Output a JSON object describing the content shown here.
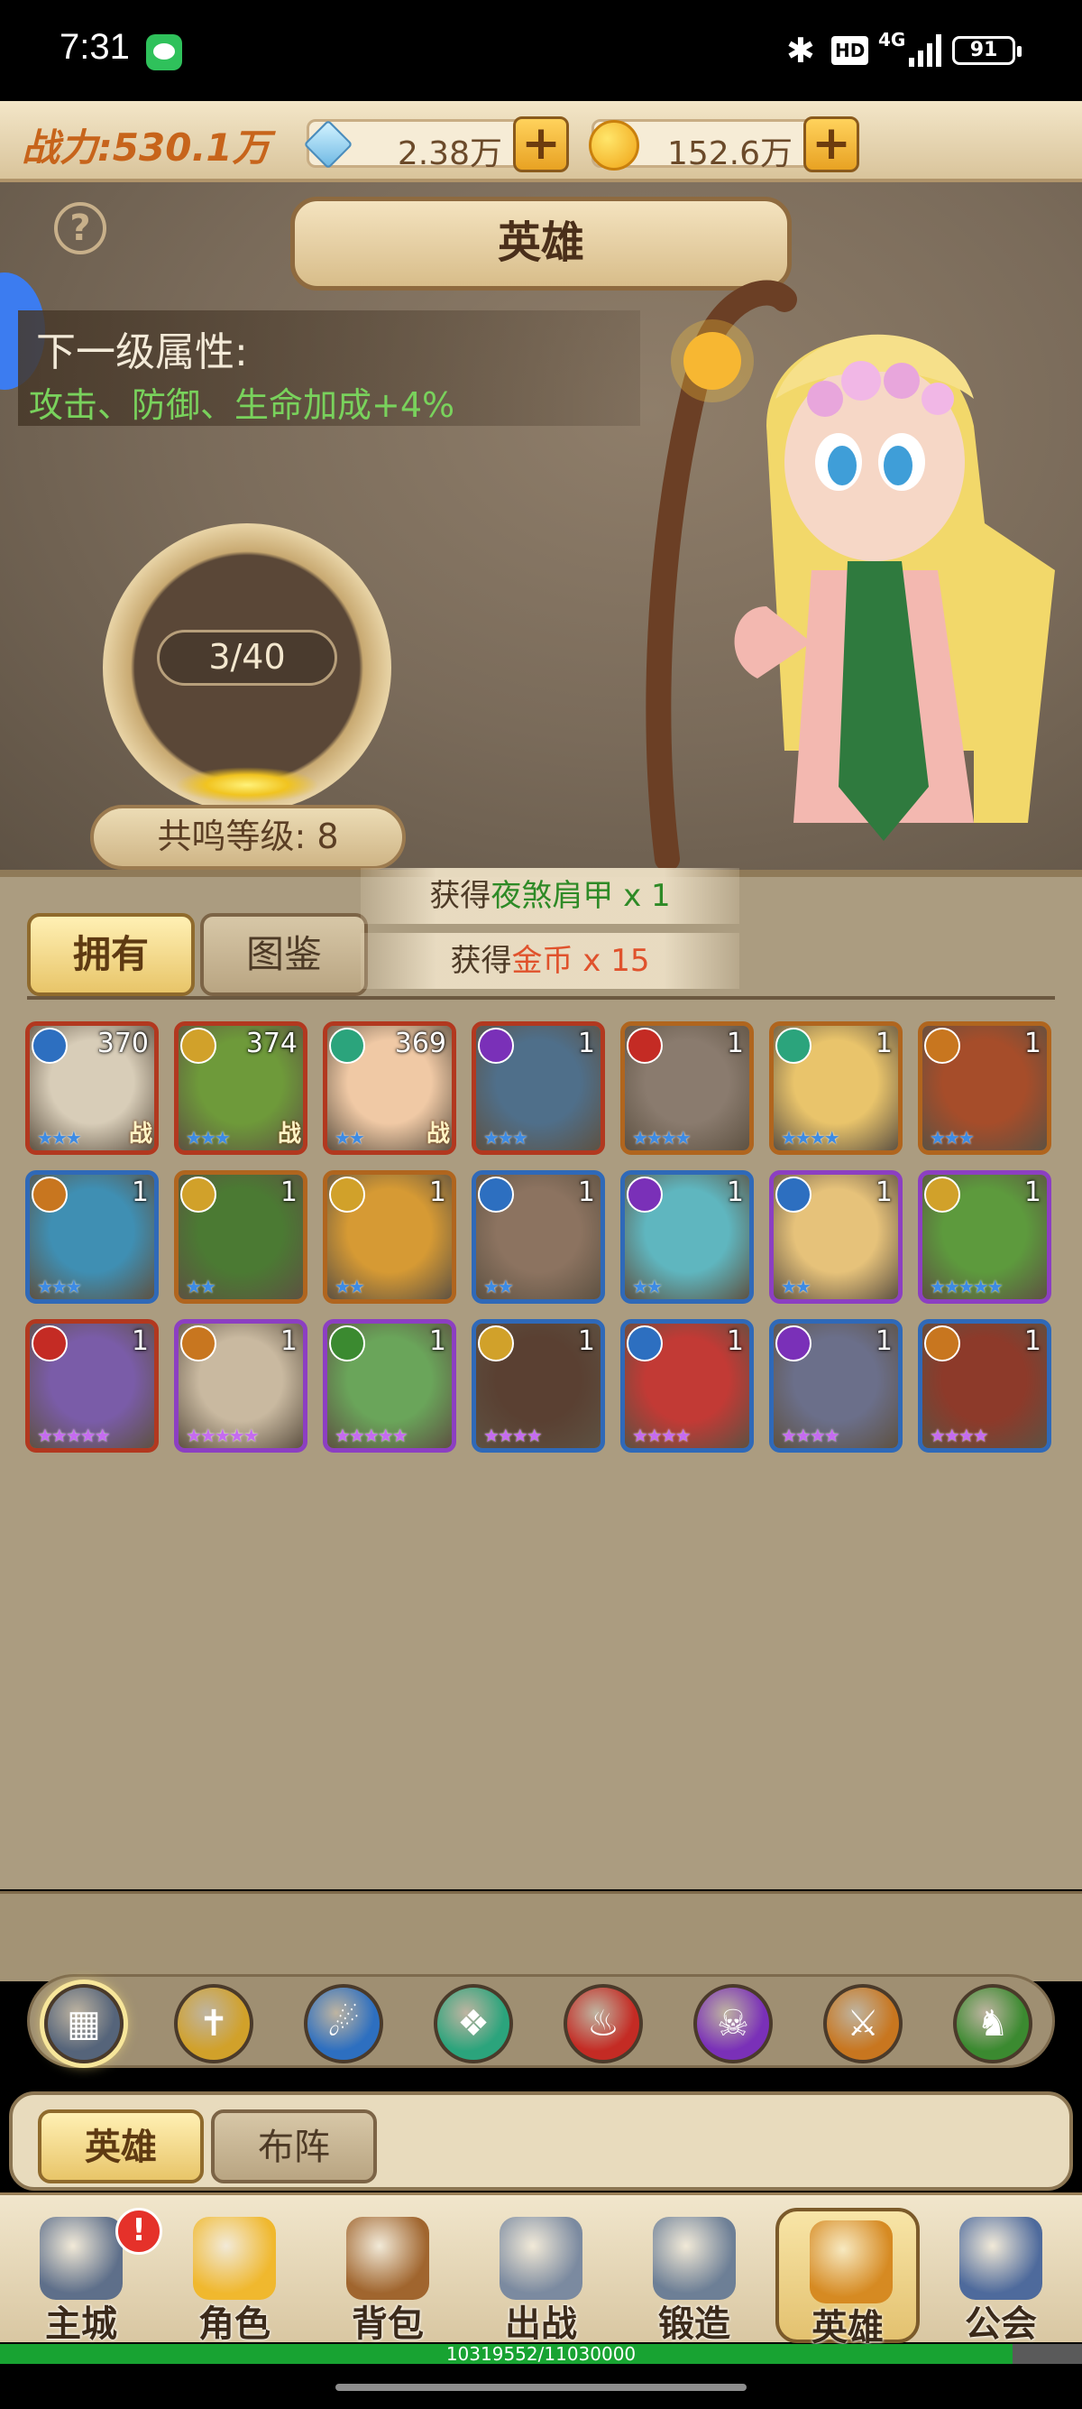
{
  "status_bar": {
    "time": "7:31",
    "hd": "HD",
    "network": "4G",
    "battery": "91",
    "icons": [
      "wechat-icon",
      "bluetooth-icon",
      "signal-icon",
      "battery-icon"
    ]
  },
  "top_bar": {
    "power": "战力:530.1万",
    "diamonds": "2.38万",
    "gold": "152.6万"
  },
  "scene": {
    "title": "英雄",
    "next_level_label": "下一级属性:",
    "next_level_bonus": "攻击、防御、生命加成+4%",
    "progress_text": "3/40",
    "resonance_level": "共鸣等级: 8"
  },
  "tabs": {
    "owned": "拥有",
    "guide": "图鉴"
  },
  "toasts": [
    {
      "prefix": "获得",
      "item": "夜煞肩甲",
      "suffix": " x 1",
      "color": "green"
    },
    {
      "prefix": "获得",
      "item": "金币",
      "suffix": " x 15",
      "color": "red"
    }
  ],
  "heroes": [
    {
      "level": "370",
      "stars": "★★★",
      "battle": "战",
      "border": "red",
      "faction": "water",
      "face": "#d8cdb8"
    },
    {
      "level": "374",
      "stars": "★★★",
      "battle": "战",
      "border": "red",
      "faction": "holy",
      "face": "#6e9a3a"
    },
    {
      "level": "369",
      "stars": "★★",
      "battle": "战",
      "border": "red",
      "faction": "nature",
      "face": "#f0c9a5"
    },
    {
      "level": "1",
      "stars": "★★★",
      "battle": "",
      "border": "red",
      "faction": "shadow",
      "face": "#4f6f8a"
    },
    {
      "level": "1",
      "stars": "★★★★",
      "battle": "",
      "border": "gold",
      "faction": "fire",
      "face": "#8a7b6e"
    },
    {
      "level": "1",
      "stars": "★★★★",
      "battle": "",
      "border": "gold",
      "faction": "nature",
      "face": "#e9c46b"
    },
    {
      "level": "1",
      "stars": "★★★",
      "battle": "",
      "border": "gold",
      "faction": "chaos",
      "face": "#a64d2a"
    },
    {
      "level": "1",
      "stars": "★★★",
      "battle": "",
      "border": "blue",
      "faction": "chaos",
      "face": "#3f8fb3"
    },
    {
      "level": "1",
      "stars": "★★",
      "battle": "",
      "border": "gold",
      "faction": "holy",
      "face": "#4b7a33"
    },
    {
      "level": "1",
      "stars": "★★",
      "battle": "",
      "border": "gold",
      "faction": "holy",
      "face": "#d69a34"
    },
    {
      "level": "1",
      "stars": "★★",
      "battle": "",
      "border": "blue",
      "faction": "water",
      "face": "#8c7360"
    },
    {
      "level": "1",
      "stars": "★★",
      "battle": "",
      "border": "blue",
      "faction": "shadow",
      "face": "#5fb6bf"
    },
    {
      "level": "1",
      "stars": "★★",
      "battle": "",
      "border": "purple",
      "faction": "water",
      "face": "#e6c27a"
    },
    {
      "level": "1",
      "stars": "★★★★★",
      "battle": "",
      "border": "purple",
      "faction": "holy",
      "face": "#5d9a3d"
    },
    {
      "level": "1",
      "stars": "★★★★★",
      "battle": "",
      "border": "red",
      "faction": "fire",
      "face": "#7a5ca8",
      "stars_color": "purple"
    },
    {
      "level": "1",
      "stars": "★★★★★",
      "battle": "",
      "border": "purple",
      "faction": "chaos",
      "face": "#c9b9a0",
      "stars_color": "purple"
    },
    {
      "level": "1",
      "stars": "★★★★★",
      "battle": "",
      "border": "purple",
      "faction": "dragon",
      "face": "#6aa55a",
      "stars_color": "purple"
    },
    {
      "level": "1",
      "stars": "★★★★",
      "battle": "",
      "border": "blue",
      "faction": "holy",
      "face": "#5a4032",
      "stars_color": "purple"
    },
    {
      "level": "1",
      "stars": "★★★★",
      "battle": "",
      "border": "blue",
      "faction": "water",
      "face": "#c23a35",
      "stars_color": "purple"
    },
    {
      "level": "1",
      "stars": "★★★★",
      "battle": "",
      "border": "blue",
      "faction": "shadow",
      "face": "#6b6f8a",
      "stars_color": "purple"
    },
    {
      "level": "1",
      "stars": "★★★★",
      "battle": "",
      "border": "blue",
      "faction": "chaos",
      "face": "#8d3a2a",
      "stars_color": "purple"
    }
  ],
  "faction_filter": [
    {
      "icon": "all-factions-icon",
      "color": "#55647a",
      "glyph": "▦"
    },
    {
      "icon": "holy-faction-icon",
      "color": "#d1a12a",
      "glyph": "✝"
    },
    {
      "icon": "water-faction-icon",
      "color": "#2d6fc0",
      "glyph": "☄"
    },
    {
      "icon": "nature-faction-icon",
      "color": "#2ba47c",
      "glyph": "❖"
    },
    {
      "icon": "fire-faction-icon",
      "color": "#c42b24",
      "glyph": "♨"
    },
    {
      "icon": "shadow-faction-icon",
      "color": "#7a30b8",
      "glyph": "☠"
    },
    {
      "icon": "chaos-faction-icon",
      "color": "#c8761f",
      "glyph": "⚔"
    },
    {
      "icon": "dragon-faction-icon",
      "color": "#3b8a30",
      "glyph": "♞"
    }
  ],
  "sub_tabs": {
    "heroes": "英雄",
    "formation": "布阵"
  },
  "nav": [
    {
      "label": "主城",
      "icon": "castle-icon",
      "color": "#5e6f8a",
      "alert": "!"
    },
    {
      "label": "角色",
      "icon": "crown-icon",
      "color": "#f0b82e",
      "alert": ""
    },
    {
      "label": "背包",
      "icon": "bag-icon",
      "color": "#a0652e",
      "alert": ""
    },
    {
      "label": "出战",
      "icon": "swords-icon",
      "color": "#7b8aa0",
      "alert": ""
    },
    {
      "label": "锻造",
      "icon": "hammer-icon",
      "color": "#6d7f96",
      "alert": ""
    },
    {
      "label": "英雄",
      "icon": "hero-fist-icon",
      "color": "#d68a22",
      "alert": ""
    },
    {
      "label": "公会",
      "icon": "guild-shield-icon",
      "color": "#4e6a9c",
      "alert": ""
    }
  ],
  "xp": {
    "text": "10319552/11030000",
    "fraction": 0.9356
  },
  "faction_colors": {
    "water": "#2d6fc0",
    "holy": "#d1a12a",
    "nature": "#2ba47c",
    "shadow": "#7a30b8",
    "fire": "#c42b24",
    "chaos": "#c8761f",
    "dragon": "#3b8a30"
  }
}
